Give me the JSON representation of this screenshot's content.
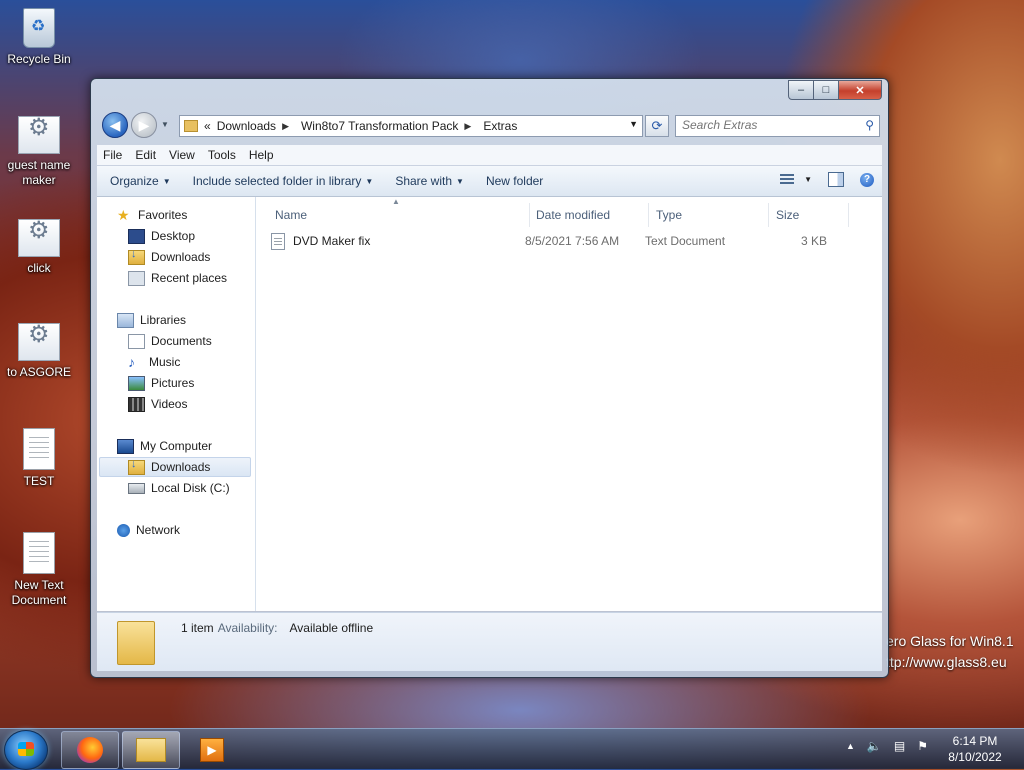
{
  "desktop": {
    "icons": [
      {
        "label": "Recycle Bin",
        "icon": "recycle-bin-icon"
      },
      {
        "label": "guest name maker",
        "icon": "script-file-icon"
      },
      {
        "label": "click",
        "icon": "script-file-icon"
      },
      {
        "label": "to ASGORE",
        "icon": "script-file-icon"
      },
      {
        "label": "TEST",
        "icon": "text-document-icon"
      },
      {
        "label": "New Text Document",
        "icon": "text-document-icon"
      }
    ],
    "watermark_line1": "ero Glass for Win8.1",
    "watermark_line2": "ttp://www.glass8.eu"
  },
  "window": {
    "caption_buttons": {
      "minimize": "‒",
      "maximize": "□",
      "close": "✕"
    },
    "address": {
      "overflow": "«",
      "crumbs": [
        "Downloads",
        "Win8to7 Transformation Pack",
        "Extras"
      ]
    },
    "search": {
      "placeholder": "Search Extras"
    },
    "menu": [
      "File",
      "Edit",
      "View",
      "Tools",
      "Help"
    ],
    "commands": {
      "organize": "Organize",
      "include": "Include selected folder in library",
      "share": "Share with",
      "new_folder": "New folder"
    },
    "nav": {
      "favorites": "Favorites",
      "desktop": "Desktop",
      "downloads": "Downloads",
      "recent": "Recent places",
      "libraries": "Libraries",
      "documents": "Documents",
      "music": "Music",
      "pictures": "Pictures",
      "videos": "Videos",
      "computer": "My Computer",
      "computer_downloads": "Downloads",
      "local_disk": "Local Disk (C:)",
      "network": "Network"
    },
    "columns": {
      "name": "Name",
      "date": "Date modified",
      "type": "Type",
      "size": "Size"
    },
    "files": [
      {
        "name": "DVD Maker fix",
        "date": "8/5/2021 7:56 AM",
        "type": "Text Document",
        "size": "3 KB"
      }
    ],
    "details": {
      "count": "1 item",
      "availability_label": "Availability:",
      "availability_value": "Available offline"
    }
  },
  "taskbar": {
    "apps": [
      "firefox-icon",
      "windows-explorer-icon",
      "media-player-icon"
    ],
    "time": "6:14 PM",
    "date": "8/10/2022"
  }
}
